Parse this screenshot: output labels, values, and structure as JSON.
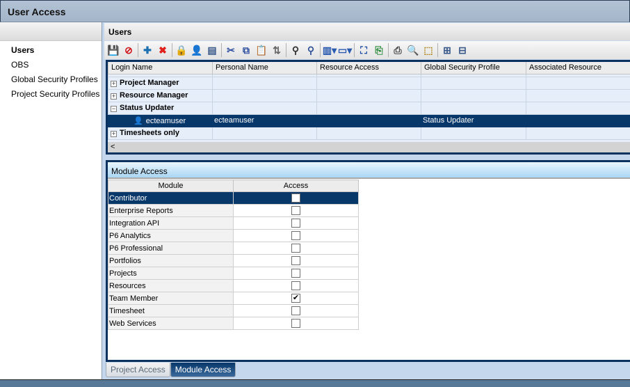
{
  "window": {
    "title": "User Access"
  },
  "sidebar": {
    "items": [
      {
        "label": "Users",
        "selected": true
      },
      {
        "label": "OBS"
      },
      {
        "label": "Global Security Profiles"
      },
      {
        "label": "Project Security Profiles"
      }
    ]
  },
  "users_panel": {
    "title": "Users",
    "toolbar": [
      {
        "icon": "save-icon",
        "glyph": "💾",
        "color": "#2a3c8a"
      },
      {
        "icon": "cancel-icon",
        "glyph": "⊘",
        "color": "#d0141a"
      },
      {
        "sep": true
      },
      {
        "icon": "add-icon",
        "glyph": "✚",
        "color": "#1a6fb0"
      },
      {
        "icon": "delete-icon",
        "glyph": "✖",
        "color": "#e0201a"
      },
      {
        "sep": true
      },
      {
        "icon": "lock-icon",
        "glyph": "🔒",
        "color": "#c8a010"
      },
      {
        "icon": "add-user-icon",
        "glyph": "👤",
        "color": "#304a6a"
      },
      {
        "icon": "details-icon",
        "glyph": "▤",
        "color": "#3a5a8a"
      },
      {
        "sep": true
      },
      {
        "icon": "cut-icon",
        "glyph": "✂",
        "color": "#3050a0"
      },
      {
        "icon": "copy-icon",
        "glyph": "⧉",
        "color": "#3050a0"
      },
      {
        "icon": "paste-icon",
        "glyph": "📋",
        "color": "#888888"
      },
      {
        "icon": "sort-icon",
        "glyph": "⇅",
        "color": "#666666"
      },
      {
        "sep": true
      },
      {
        "icon": "find-icon",
        "glyph": "⚲",
        "color": "#333333"
      },
      {
        "icon": "find-next-icon",
        "glyph": "⚲",
        "color": "#335599"
      },
      {
        "sep": true
      },
      {
        "icon": "columns-icon",
        "glyph": "▥▾",
        "color": "#2a5ab0"
      },
      {
        "icon": "layout-icon",
        "glyph": "▭▾",
        "color": "#2a5ab0"
      },
      {
        "sep": true
      },
      {
        "icon": "expand-view-icon",
        "glyph": "⛶",
        "color": "#1a4aa0"
      },
      {
        "icon": "export-excel-icon",
        "glyph": "⎘",
        "color": "#2a8a3a"
      },
      {
        "sep": true
      },
      {
        "icon": "print-icon",
        "glyph": "⎙",
        "color": "#444444"
      },
      {
        "icon": "print-preview-icon",
        "glyph": "🔍",
        "color": "#444444"
      },
      {
        "icon": "page-setup-icon",
        "glyph": "⬚",
        "color": "#b08a20"
      },
      {
        "sep": true
      },
      {
        "icon": "expand-all-icon",
        "glyph": "⊞",
        "color": "#3a5a8a"
      },
      {
        "icon": "collapse-all-icon",
        "glyph": "⊟",
        "color": "#3a5a8a"
      }
    ],
    "columns": [
      "Login Name",
      "Personal Name",
      "Resource Access",
      "Global Security Profile",
      "Associated Resource"
    ],
    "rows": [
      {
        "type": "group",
        "expanded": false,
        "cells": [
          "Project Manager",
          "",
          "",
          "",
          ""
        ]
      },
      {
        "type": "group",
        "expanded": false,
        "cells": [
          "Resource Manager",
          "",
          "",
          "",
          ""
        ]
      },
      {
        "type": "group",
        "expanded": true,
        "cells": [
          "Status Updater",
          "",
          "",
          "",
          ""
        ]
      },
      {
        "type": "user",
        "selected": true,
        "cells": [
          "ecteamuser",
          "ecteamuser",
          "",
          "Status Updater",
          ""
        ]
      },
      {
        "type": "group",
        "expanded": false,
        "cells": [
          "Timesheets only",
          "",
          "",
          "",
          ""
        ]
      }
    ],
    "scroll_left": "<"
  },
  "module_access": {
    "title": "Module Access",
    "columns": [
      "Module",
      "Access"
    ],
    "rows": [
      {
        "module": "Contributor",
        "access": false,
        "selected": true
      },
      {
        "module": "Enterprise Reports",
        "access": false
      },
      {
        "module": "Integration API",
        "access": false
      },
      {
        "module": "P6 Analytics",
        "access": false
      },
      {
        "module": "P6 Professional",
        "access": false
      },
      {
        "module": "Portfolios",
        "access": false
      },
      {
        "module": "Projects",
        "access": false
      },
      {
        "module": "Resources",
        "access": false
      },
      {
        "module": "Team Member",
        "access": true
      },
      {
        "module": "Timesheet",
        "access": false
      },
      {
        "module": "Web Services",
        "access": false
      }
    ]
  },
  "tabs": [
    {
      "label": "Project Access",
      "active": false
    },
    {
      "label": "Module Access",
      "active": true
    }
  ],
  "colors": {
    "selection": "#08376a",
    "frame": "#0b325f"
  }
}
